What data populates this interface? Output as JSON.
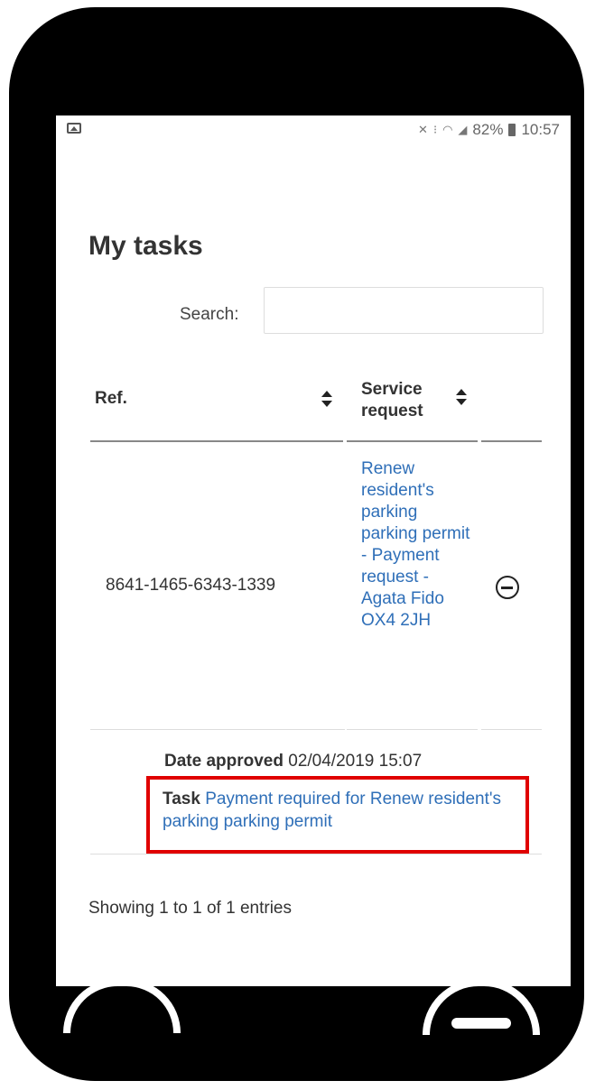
{
  "statusbar": {
    "battery": "82%",
    "time": "10:57",
    "icons": [
      "image-icon",
      "mute-icon",
      "network-icon",
      "wifi-icon",
      "signal-icon",
      "battery-icon"
    ]
  },
  "page": {
    "title": "My tasks",
    "search_label": "Search:",
    "search_value": ""
  },
  "table": {
    "columns": [
      "Ref.",
      "Service request"
    ],
    "rows": [
      {
        "ref": "8641-1465-6343-1339",
        "service_request": "Renew resident's parking parking permit - Payment request - Agata Fido OX4 2JH",
        "detail": {
          "date_label": "Date approved",
          "date_value": "02/04/2019 15:07",
          "task_label": "Task",
          "task_link": "Payment required for Renew resident's parking parking permit"
        }
      }
    ],
    "info": "Showing 1 to 1 of 1 entries"
  },
  "colors": {
    "link": "#2f6fb8",
    "highlight": "#e00000",
    "frame": "#000000"
  }
}
